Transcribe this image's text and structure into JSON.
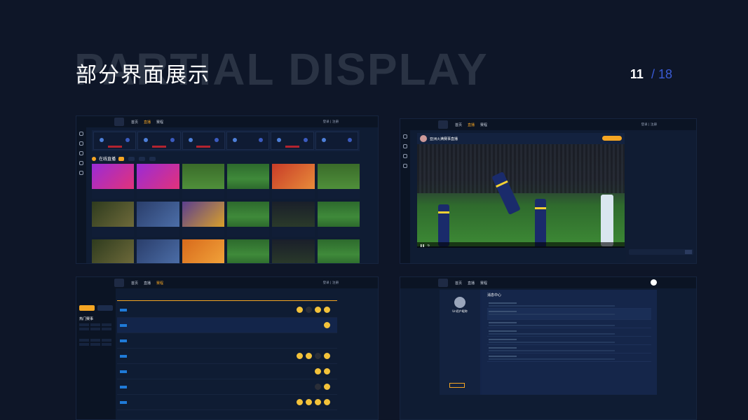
{
  "header": {
    "bg_word": "PARTIAL  DISPLAY",
    "title": "部分界面展示",
    "page_current": "11",
    "page_sep": "/",
    "page_total": "18"
  },
  "nav": {
    "home": "首页",
    "live": "直播",
    "schedule": "赛程",
    "login": "登录 | 注册"
  },
  "shot1": {
    "live_heading": "在线直播"
  },
  "shot2": {
    "streamer_name": "亚洲火满赛事直播"
  },
  "shot3": {
    "hot_label": "热门赛事"
  },
  "shot4": {
    "center_title": "消息中心",
    "user_name": "Un用户昵称"
  },
  "colors": {
    "background": "#0e1628",
    "accent": "#f5a623",
    "page_total": "#3a5bd6"
  }
}
